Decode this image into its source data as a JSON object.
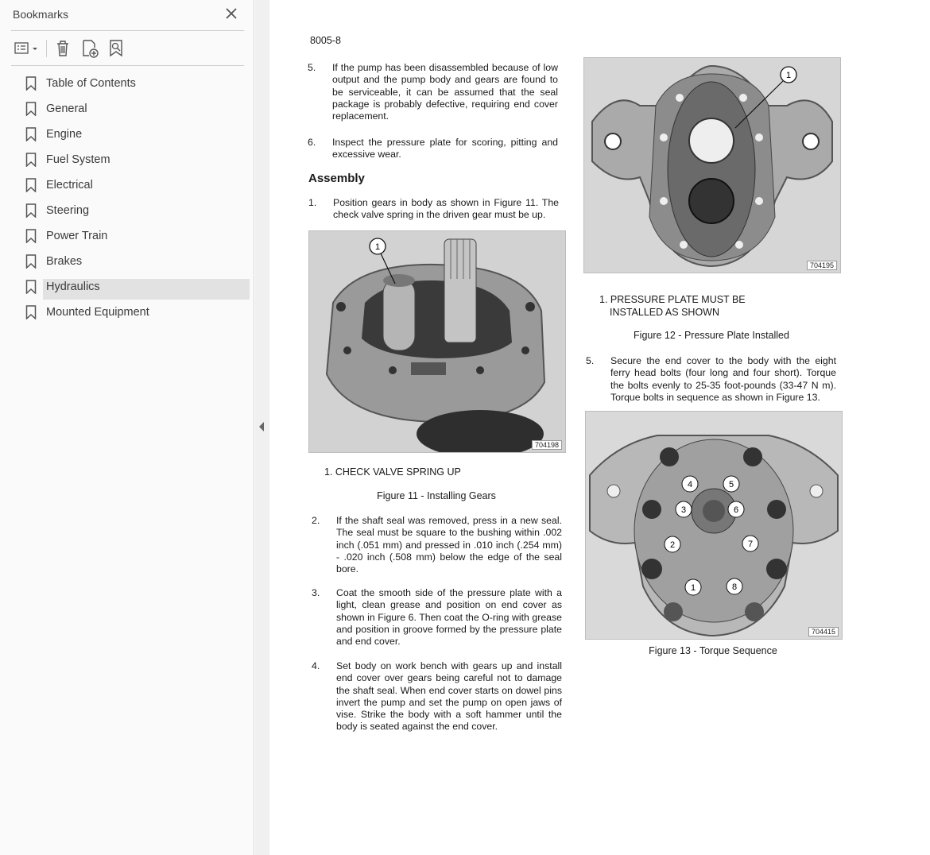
{
  "sidebar": {
    "title": "Bookmarks",
    "items": [
      {
        "label": "Table of Contents"
      },
      {
        "label": "General"
      },
      {
        "label": "Engine"
      },
      {
        "label": "Fuel System"
      },
      {
        "label": "Electrical"
      },
      {
        "label": "Steering"
      },
      {
        "label": "Power Train"
      },
      {
        "label": "Brakes"
      },
      {
        "label": "Hydraulics",
        "selected": true
      },
      {
        "label": "Mounted Equipment"
      }
    ],
    "icons": [
      "bookmark-options-icon",
      "delete-bookmark-icon",
      "add-bookmark-icon",
      "find-bookmark-icon",
      "close-icon"
    ]
  },
  "page": {
    "page_number": "8005-8",
    "step5a_num": "5.",
    "step5a_text": "If the pump has been disassembled because of low output and the pump body and gears are found to be serviceable, it can be assumed that the seal package is probably defective, requiring end cover replacement.",
    "step6_num": "6.",
    "step6_text": "Inspect the pressure plate for scoring, pitting and excessive wear.",
    "assembly_heading": "Assembly",
    "step1_num": "1.",
    "step1_text": "Position gears in body as shown in Figure 11. The check valve spring in the driven gear must be up.",
    "fig11_code": "704198",
    "fig11_callout_num": "1",
    "fig11_legend": "1. CHECK VALVE SPRING UP",
    "fig11_caption": "Figure 11 - Installing Gears",
    "step2_num": "2.",
    "step2_text": "If the shaft seal was removed, press in a new seal. The seal must be square to the bushing within .002 inch (.051 mm) and pressed in .010 inch (.254 mm) - .020 inch (.508 mm) below the edge of the seal bore.",
    "step3_num": "3.",
    "step3_text": "Coat the smooth side of the pressure plate with a light, clean grease and position on end cover as shown in Figure 6. Then coat the O-ring with grease and position in groove formed by the pressure plate and end cover.",
    "step4_num": "4.",
    "step4_text": "Set body on work bench with gears up and install end cover over gears being careful not to damage the shaft seal. When end cover starts on dowel pins invert the pump and set the pump on open jaws of vise. Strike the body with a soft hammer until the body is seated against the end cover.",
    "fig12_code": "704195",
    "fig12_callout_num": "1",
    "fig12_legend_line1": "1. PRESSURE PLATE MUST BE",
    "fig12_legend_line2": "INSTALLED AS SHOWN",
    "fig12_caption": "Figure 12 - Pressure Plate Installed",
    "step5b_num": "5.",
    "step5b_text": "Secure the end cover to the body with the eight ferry head bolts (four long and four short). Torque the bolts evenly to 25-35 foot-pounds (33-47 N m). Torque bolts in sequence as shown in Figure 13.",
    "fig13_code": "704415",
    "fig13_sequence": [
      "1",
      "2",
      "3",
      "4",
      "5",
      "6",
      "7",
      "8"
    ],
    "fig13_caption": "Figure 13 - Torque Sequence"
  }
}
